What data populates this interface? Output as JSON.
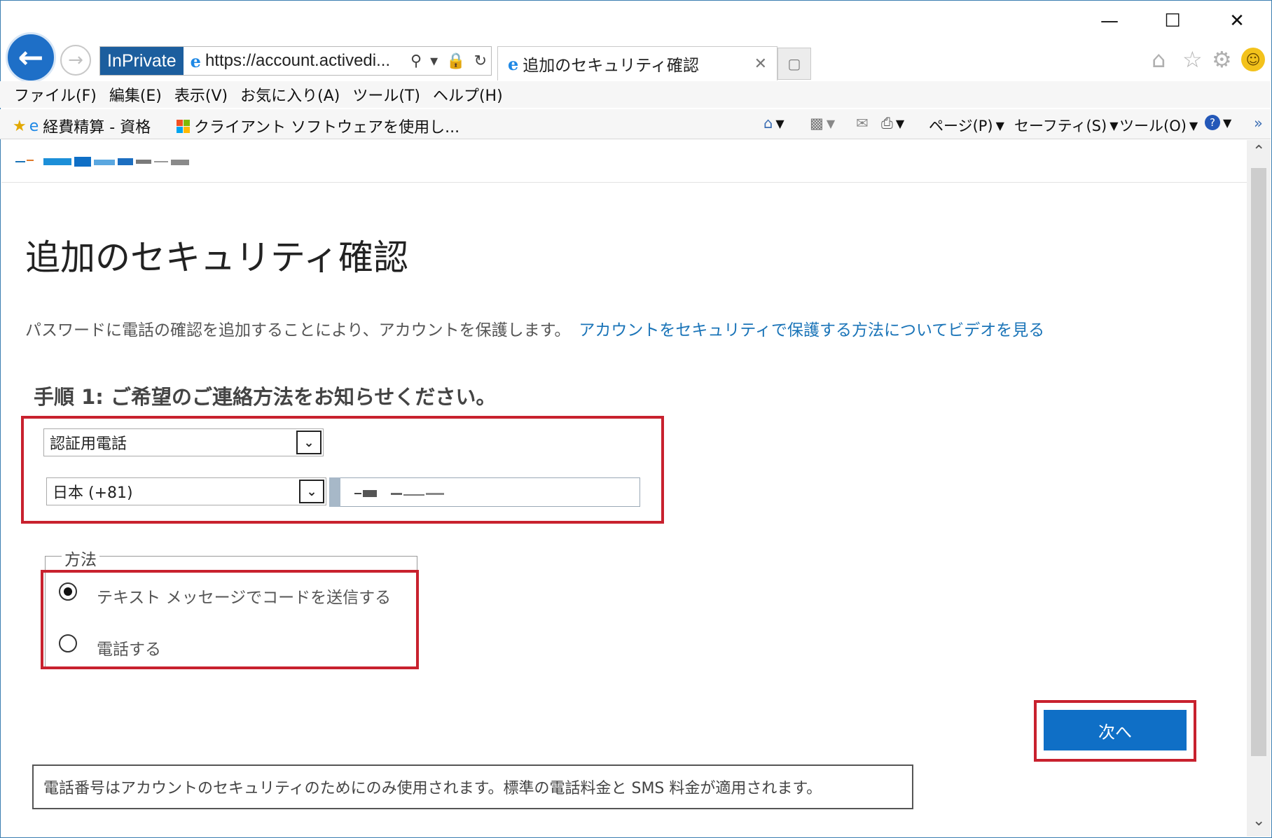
{
  "window": {
    "min_icon": "minimize-icon",
    "max_icon": "maximize-icon",
    "close_icon": "close-icon"
  },
  "browser": {
    "inprivate": "InPrivate",
    "url": "https://account.activedi...",
    "tab_title": "追加のセキュリティ確認",
    "menu": [
      "ファイル(F)",
      "編集(E)",
      "表示(V)",
      "お気に入り(A)",
      "ツール(T)",
      "ヘルプ(H)"
    ],
    "favorites": [
      "経費精算 - 資格",
      "クライアント ソフトウェアを使用し..."
    ],
    "commands": [
      "ページ(P)",
      "セーフティ(S)",
      "ツール(O)"
    ]
  },
  "page": {
    "title": "追加のセキュリティ確認",
    "intro": "パスワードに電話の確認を追加することにより、アカウントを保護します。",
    "video_link": "アカウントをセキュリティで保護する方法についてビデオを見る",
    "step1": "手順 1: ご希望のご連絡方法をお知らせください。",
    "contact_method": "認証用電話",
    "country": "日本 (+81)",
    "method_legend": "方法",
    "option_text": "テキスト メッセージでコードを送信する",
    "option_call": "電話する",
    "selected_option": "テキスト メッセージでコードを送信する",
    "next_button": "次へ",
    "note": "電話番号はアカウントのセキュリティのためにのみ使用されます。標準の電話料金と SMS 料金が適用されます。"
  },
  "colors": {
    "accent": "#0f6fc6",
    "link": "#1a74b8",
    "highlight": "#c8212e"
  }
}
